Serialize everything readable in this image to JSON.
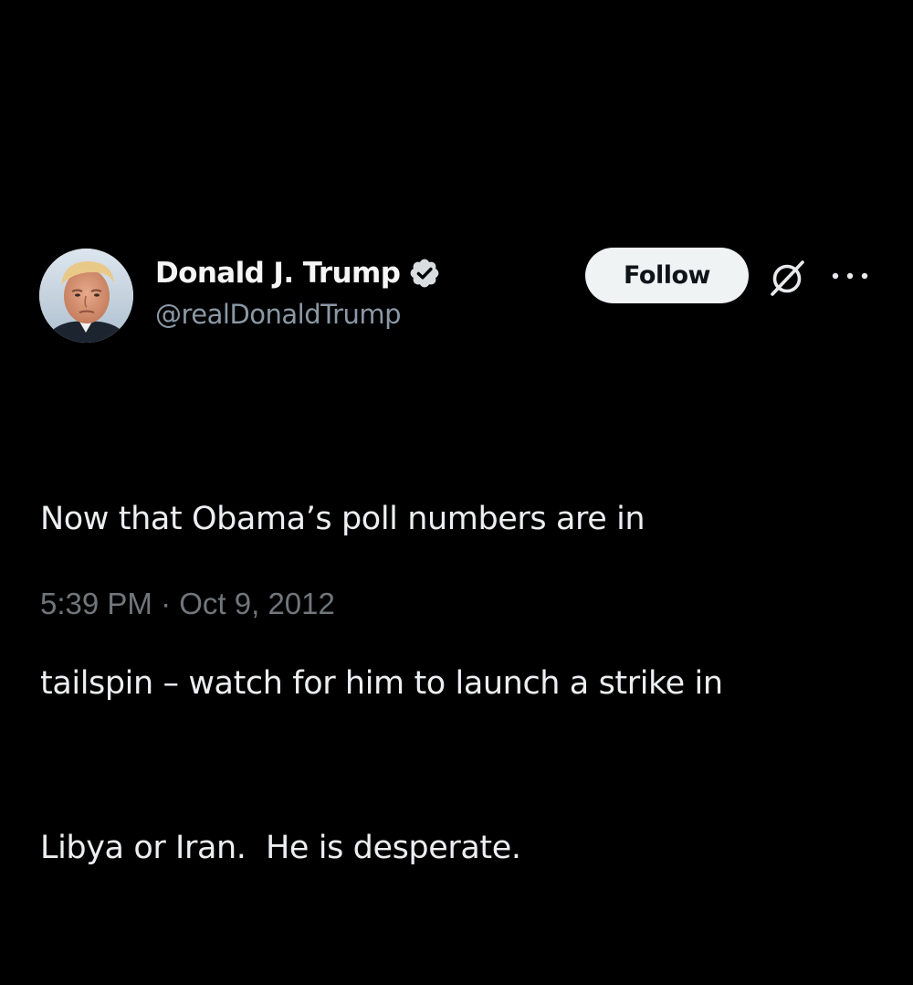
{
  "author": {
    "display_name": "Donald J. Trump",
    "handle": "@realDonaldTrump",
    "verified": true
  },
  "actions": {
    "follow_label": "Follow",
    "grok_icon": "grok-icon",
    "more_icon": "more-icon"
  },
  "tweet": {
    "lines": [
      "Now that Obama’s poll numbers are in",
      "tailspin – watch for him to launch a strike in",
      "Libya or Iran.  He is desperate."
    ]
  },
  "meta": {
    "time": "5:39 PM",
    "separator": "·",
    "date": "Oct 9, 2012"
  },
  "colors": {
    "background": "#000000",
    "text_primary": "#e7e9ea",
    "text_secondary": "#71767b",
    "follow_bg": "#eff3f4",
    "follow_text": "#0f1419",
    "badge": "#d9dde0"
  }
}
